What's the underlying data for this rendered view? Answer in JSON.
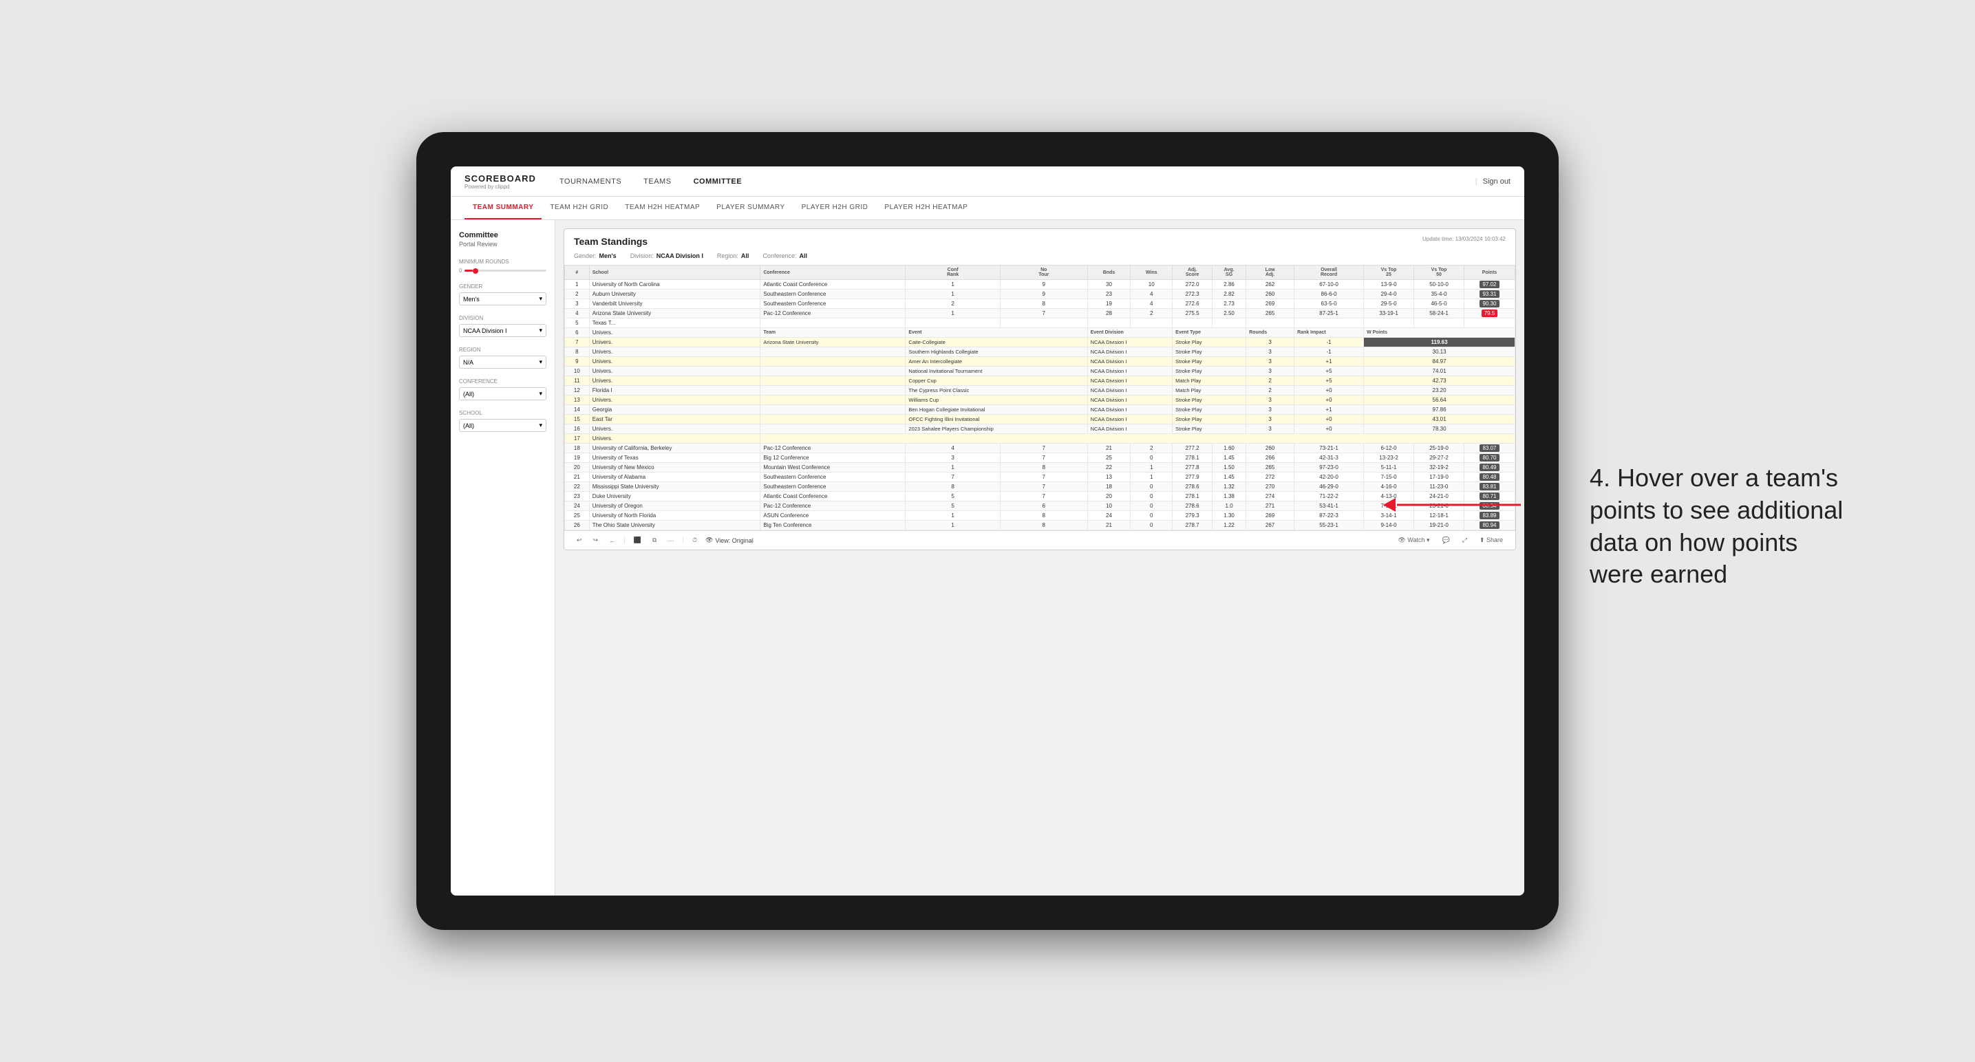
{
  "app": {
    "logo": "SCOREBOARD",
    "logo_sub": "Powered by clippd"
  },
  "nav": {
    "items": [
      "TOURNAMENTS",
      "TEAMS",
      "COMMITTEE"
    ],
    "active": "COMMITTEE",
    "sign_out": "Sign out"
  },
  "sub_nav": {
    "items": [
      "TEAM SUMMARY",
      "TEAM H2H GRID",
      "TEAM H2H HEATMAP",
      "PLAYER SUMMARY",
      "PLAYER H2H GRID",
      "PLAYER H2H HEATMAP"
    ],
    "active": "TEAM SUMMARY"
  },
  "sidebar": {
    "title": "Committee",
    "subtitle": "Portal Review",
    "sections": [
      {
        "label": "Minimum Rounds",
        "type": "slider",
        "value": "0"
      },
      {
        "label": "Gender",
        "type": "select",
        "value": "Men's"
      },
      {
        "label": "Division",
        "type": "select",
        "value": "NCAA Division I"
      },
      {
        "label": "Region",
        "type": "select",
        "value": "N/A"
      },
      {
        "label": "Conference",
        "type": "select",
        "value": "(All)"
      },
      {
        "label": "School",
        "type": "select",
        "value": "(All)"
      }
    ]
  },
  "report": {
    "title": "Team Standings",
    "update_time": "Update time: 13/03/2024 10:03:42",
    "filters": {
      "gender": "Men's",
      "gender_label": "Gender:",
      "division": "NCAA Division I",
      "division_label": "Division:",
      "region": "All",
      "region_label": "Region:",
      "conference": "All",
      "conference_label": "Conference:"
    },
    "columns": [
      "#",
      "School",
      "Conference",
      "Conf Rank",
      "No Tour",
      "Bnds",
      "Wins",
      "Adj. Score",
      "Avg. SG",
      "Low Adj.",
      "Overall Record",
      "Vs Top 25",
      "Vs Top 50",
      "Points"
    ],
    "rows": [
      {
        "rank": 1,
        "school": "University of North Carolina",
        "conf": "Atlantic Coast Conference",
        "conf_rank": 1,
        "tours": 9,
        "bnds": 30,
        "wins": 10,
        "adj_score": 272.0,
        "avg_sg": 2.86,
        "low_adj": 262,
        "record": "67-10-0",
        "vs25": "13-9-0",
        "vs50": "50-10-0",
        "points": "97.02",
        "highlighted": true
      },
      {
        "rank": 2,
        "school": "Auburn University",
        "conf": "Southeastern Conference",
        "conf_rank": 1,
        "tours": 9,
        "bnds": 23,
        "wins": 4,
        "adj_score": 272.3,
        "avg_sg": 2.82,
        "low_adj": 260,
        "record": "86-6-0",
        "vs25": "29-4-0",
        "vs50": "35-4-0",
        "points": "93.31"
      },
      {
        "rank": 3,
        "school": "Vanderbilt University",
        "conf": "Southeastern Conference",
        "conf_rank": 2,
        "tours": 8,
        "bnds": 19,
        "wins": 4,
        "adj_score": 272.6,
        "avg_sg": 2.73,
        "low_adj": 269,
        "record": "63-5-0",
        "vs25": "29-5-0",
        "vs50": "46-5-0",
        "points": "90.30"
      },
      {
        "rank": 4,
        "school": "Arizona State University",
        "conf": "Pac-12 Conference",
        "conf_rank": 1,
        "tours": 7,
        "bnds": 28,
        "wins": 2,
        "adj_score": 275.5,
        "avg_sg": 2.5,
        "low_adj": 265,
        "record": "87-25-1",
        "vs25": "33-19-1",
        "vs50": "58-24-1",
        "points": "79.5",
        "highlighted": true
      },
      {
        "rank": 5,
        "school": "Texas T...",
        "conf": "",
        "conf_rank": "",
        "tours": "",
        "bnds": "",
        "wins": "",
        "adj_score": "",
        "avg_sg": "",
        "low_adj": "",
        "record": "",
        "vs25": "",
        "vs50": "",
        "points": ""
      },
      {
        "rank": 6,
        "school": "Univers.",
        "conf": "",
        "conf_rank": "",
        "tours": "",
        "bnds": "",
        "wins": "",
        "adj_score": "",
        "avg_sg": "",
        "low_adj": "",
        "record": "",
        "vs25": "",
        "vs50": "",
        "points": "",
        "event_expanded": true
      },
      {
        "rank": 7,
        "school": "Univers.",
        "event_expanded": true,
        "team": "Arizona State University",
        "event": "Caite-Collegiate",
        "event_div": "NCAA Division I",
        "event_type": "Stroke Play",
        "rounds": 3,
        "rank_impact": "-1",
        "w_points": "119.63"
      },
      {
        "rank": 8,
        "school": "Univers.",
        "event_expanded": true,
        "team": "",
        "event": "Southern Highlands Collegiate",
        "event_div": "NCAA Division I",
        "event_type": "Stroke Play",
        "rounds": 3,
        "rank_impact": "-1",
        "w_points": "30.13"
      },
      {
        "rank": 9,
        "school": "Univers.",
        "event_expanded": true,
        "team": "",
        "event": "Amer An Intercollegiate",
        "event_div": "NCAA Division I",
        "event_type": "Stroke Play",
        "rounds": 3,
        "rank_impact": "+1",
        "w_points": "84.97"
      },
      {
        "rank": 10,
        "school": "Univers.",
        "event_expanded": true,
        "team": "",
        "event": "National Invitational Tournament",
        "event_div": "NCAA Division I",
        "event_type": "Stroke Play",
        "rounds": 3,
        "rank_impact": "+5",
        "w_points": "74.01"
      },
      {
        "rank": 11,
        "school": "Univers.",
        "event_expanded": true,
        "team": "",
        "event": "Copper Cup",
        "event_div": "NCAA Division I",
        "event_type": "Match Play",
        "rounds": 2,
        "rank_impact": "+5",
        "w_points": "42.73"
      },
      {
        "rank": 12,
        "school": "Florida I",
        "event_expanded": true,
        "team": "",
        "event": "The Cypress Point Classic",
        "event_div": "NCAA Division I",
        "event_type": "Match Play",
        "rounds": 2,
        "rank_impact": "+0",
        "w_points": "23.20"
      },
      {
        "rank": 13,
        "school": "Univers.",
        "event_expanded": true,
        "team": "",
        "event": "Williams Cup",
        "event_div": "NCAA Division I",
        "event_type": "Stroke Play",
        "rounds": 3,
        "rank_impact": "+0",
        "w_points": "56.64"
      },
      {
        "rank": 14,
        "school": "Georgia",
        "event_expanded": true,
        "team": "",
        "event": "Ben Hogan Collegiate Invitational",
        "event_div": "NCAA Division I",
        "event_type": "Stroke Play",
        "rounds": 3,
        "rank_impact": "+1",
        "w_points": "97.86"
      },
      {
        "rank": 15,
        "school": "East Tar",
        "event_expanded": true,
        "team": "",
        "event": "OFCC Fighting Illini Invitational",
        "event_div": "NCAA Division I",
        "event_type": "Stroke Play",
        "rounds": 3,
        "rank_impact": "+0",
        "w_points": "43.01"
      },
      {
        "rank": 16,
        "school": "Univers.",
        "event_expanded": true,
        "team": "",
        "event": "2023 Sahalee Players Championship",
        "event_div": "NCAA Division I",
        "event_type": "Stroke Play",
        "rounds": 3,
        "rank_impact": "+0",
        "w_points": "78.30"
      },
      {
        "rank": 17,
        "school": "Univers.",
        "event_expanded": true
      },
      {
        "rank": 18,
        "school": "University of California, Berkeley",
        "conf": "Pac-12 Conference",
        "conf_rank": 4,
        "tours": 7,
        "bnds": 21,
        "wins": 2,
        "adj_score": 277.2,
        "avg_sg": 1.6,
        "low_adj": 260,
        "record": "73-21-1",
        "vs25": "6-12-0",
        "vs50": "25-19-0",
        "points": "83.07"
      },
      {
        "rank": 19,
        "school": "University of Texas",
        "conf": "Big 12 Conference",
        "conf_rank": 3,
        "tours": 7,
        "bnds": 25,
        "wins": 0,
        "adj_score": 278.1,
        "avg_sg": 1.45,
        "low_adj": 266,
        "record": "42-31-3",
        "vs25": "13-23-2",
        "vs50": "29-27-2",
        "points": "80.70"
      },
      {
        "rank": 20,
        "school": "University of New Mexico",
        "conf": "Mountain West Conference",
        "conf_rank": 1,
        "tours": 8,
        "bnds": 22,
        "wins": 1,
        "adj_score": 277.8,
        "avg_sg": 1.5,
        "low_adj": 265,
        "record": "97-23-0",
        "vs25": "5-11-1",
        "vs50": "32-19-2",
        "points": "80.49"
      },
      {
        "rank": 21,
        "school": "University of Alabama",
        "conf": "Southeastern Conference",
        "conf_rank": 7,
        "tours": 7,
        "bnds": 13,
        "wins": 1,
        "adj_score": 277.9,
        "avg_sg": 1.45,
        "low_adj": 272,
        "record": "42-20-0",
        "vs25": "7-15-0",
        "vs50": "17-19-0",
        "points": "80.48"
      },
      {
        "rank": 22,
        "school": "Mississippi State University",
        "conf": "Southeastern Conference",
        "conf_rank": 8,
        "tours": 7,
        "bnds": 18,
        "wins": 0,
        "adj_score": 278.6,
        "avg_sg": 1.32,
        "low_adj": 270,
        "record": "46-29-0",
        "vs25": "4-16-0",
        "vs50": "11-23-0",
        "points": "83.81"
      },
      {
        "rank": 23,
        "school": "Duke University",
        "conf": "Atlantic Coast Conference",
        "conf_rank": 5,
        "tours": 7,
        "bnds": 20,
        "wins": 0,
        "adj_score": 278.1,
        "avg_sg": 1.38,
        "low_adj": 274,
        "record": "71-22-2",
        "vs25": "4-13-0",
        "vs50": "24-21-0",
        "points": "80.71"
      },
      {
        "rank": 24,
        "school": "University of Oregon",
        "conf": "Pac-12 Conference",
        "conf_rank": 5,
        "tours": 6,
        "bnds": 10,
        "wins": 0,
        "adj_score": 278.6,
        "avg_sg": 1.0,
        "low_adj": 271,
        "record": "53-41-1",
        "vs25": "7-19-1",
        "vs50": "23-21-0",
        "points": "80.54"
      },
      {
        "rank": 25,
        "school": "University of North Florida",
        "conf": "ASUN Conference",
        "conf_rank": 1,
        "tours": 8,
        "bnds": 24,
        "wins": 0,
        "adj_score": 279.3,
        "avg_sg": 1.3,
        "low_adj": 269,
        "record": "87-22-3",
        "vs25": "3-14-1",
        "vs50": "12-18-1",
        "points": "83.89"
      },
      {
        "rank": 26,
        "school": "The Ohio State University",
        "conf": "Big Ten Conference",
        "conf_rank": 1,
        "tours": 8,
        "bnds": 21,
        "wins": 0,
        "adj_score": 278.7,
        "avg_sg": 1.22,
        "low_adj": 267,
        "record": "55-23-1",
        "vs25": "9-14-0",
        "vs50": "19-21-0",
        "points": "80.94"
      }
    ],
    "toolbar": {
      "undo": "↩",
      "redo": "↪",
      "back": "←",
      "camera": "📷",
      "copy": "⧉",
      "more": "···",
      "time": "⏱",
      "view": "View: Original",
      "watch": "Watch",
      "feedback": "💬",
      "expand": "⤢",
      "share": "Share"
    }
  },
  "annotation": {
    "text": "4. Hover over a team's points to see additional data on how points were earned"
  }
}
